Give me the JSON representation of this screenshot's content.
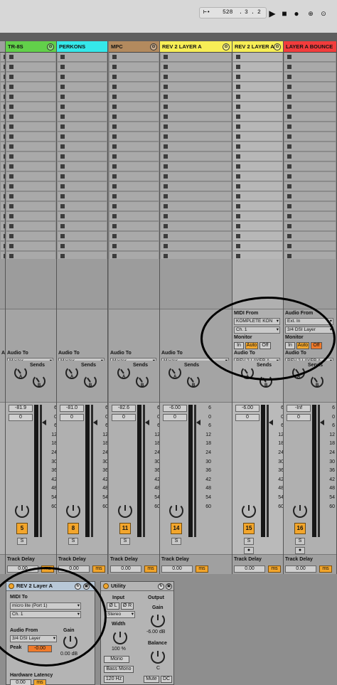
{
  "transport": {
    "bar": "528",
    "beat": "3",
    "sixteenth": "2"
  },
  "tracks": [
    {
      "id": "trk1",
      "name": "",
      "color": "#9f9f9f",
      "label": ""
    },
    {
      "id": "trk2",
      "name": "TR-8S",
      "color": "#62d04a",
      "label": "TR-8S",
      "fold": "⊙",
      "audio_to": "Master",
      "vol": "-81.9",
      "vol2": "0",
      "num": "5"
    },
    {
      "id": "trk3",
      "name": "PERKONS",
      "color": "#35e8ea",
      "label": "PERKONS",
      "fold": "",
      "audio_to": "Master",
      "vol": "-81.0",
      "vol2": "0",
      "num": "8"
    },
    {
      "id": "trk4",
      "name": "MPC",
      "color": "#b38a5e",
      "label": "MPC",
      "fold": "⊙",
      "audio_to": "Master",
      "vol": "-82.6",
      "vol2": "0",
      "num": "11"
    },
    {
      "id": "trk5",
      "name": "REV 2 LAYER A",
      "color": "#f7ee56",
      "label": "REV 2 LAYER A",
      "fold": "⊙",
      "audio_to": "Master",
      "vol": "-6.00",
      "vol2": "0",
      "num": "14"
    },
    {
      "id": "trk6",
      "name": "REV 2 LAYER A",
      "color": "#f7ee56",
      "label": "REV 2 LAYER A",
      "fold": "⊙",
      "midi_from": "MIDI From",
      "midi_dev": "KOMPLETE KON",
      "midi_ch": "Ch. 1",
      "monitor": "Monitor",
      "audio_to_label": "Audio To",
      "audio_to": "REV 2 LAYER A",
      "vol": "-6.00",
      "vol2": "0",
      "num": "15"
    },
    {
      "id": "trk7",
      "name": "LAYER A BOUNCE",
      "color": "#f23c3c",
      "label": "LAYER A BOUNCE",
      "fold": "",
      "audio_from": "Audio From",
      "audio_src": "Ext. In",
      "audio_ch": "3/4 DSI Layer",
      "monitor": "Monitor",
      "audio_to_label": "Audio To",
      "audio_to": "REV 2 LAYER A",
      "vol": "-Inf",
      "vol2": "0",
      "num": "16"
    }
  ],
  "labels": {
    "audio_to": "Audio To",
    "sends": "Sends",
    "send_a": "A",
    "send_b": "B",
    "track_delay": "Track Delay",
    "delay_val": "0.00",
    "ms": "ms",
    "solo": "S",
    "in": "In",
    "auto": "Auto",
    "off": "Off"
  },
  "scale": [
    "6",
    "0",
    "6",
    "12",
    "18",
    "24",
    "30",
    "36",
    "42",
    "48",
    "54",
    "60"
  ],
  "device1": {
    "title": "REV 2 Layer A",
    "midi_to": "MIDI To",
    "midi_dev": "micro lite (Port 1)",
    "midi_ch": "Ch. 1",
    "audio_from": "Audio From",
    "audio_src": "3/4 DSI Layer",
    "gain": "Gain",
    "peak": "Peak",
    "peak_val": "-0.00",
    "gain_val": "0.00 dB",
    "hw_latency": "Hardware Latency",
    "hw_val": "0.00",
    "ms": "ms"
  },
  "device2": {
    "title": "Utility",
    "input": "Input",
    "output": "Output",
    "l": "Ø L",
    "r": "Ø R",
    "mode": "Stereo",
    "width": "Width",
    "width_val": "100 %",
    "mono": "Mono",
    "bass_mono": "Bass Mono",
    "freq": "120 Hz",
    "gain": "Gain",
    "gain_val": "-6.00 dB",
    "balance": "Balance",
    "balance_val": "C",
    "mute": "Mute",
    "dc": "DC"
  }
}
